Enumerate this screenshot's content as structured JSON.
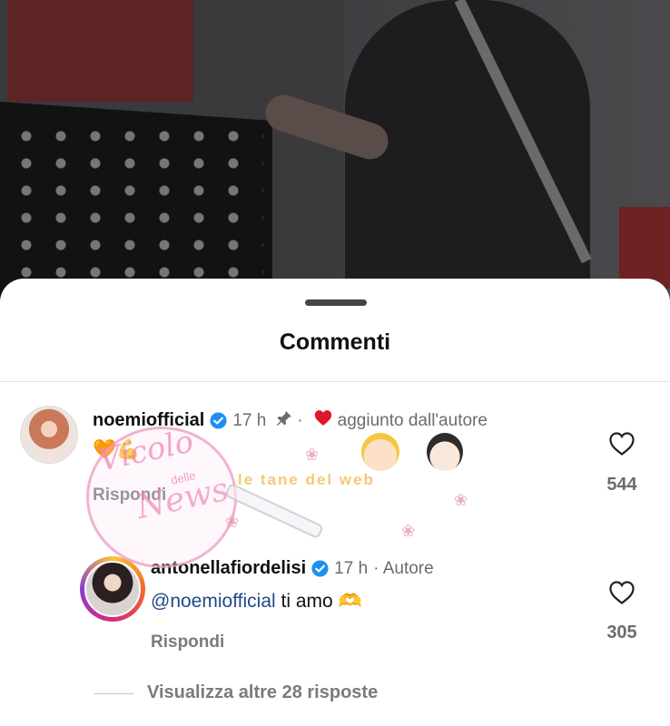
{
  "sheet": {
    "title": "Commenti"
  },
  "comments": [
    {
      "username": "noemiofficial",
      "time": "17 h",
      "liked_by_author_label": "aggiunto dall'autore",
      "body_emoji": "🧡💪",
      "reply_label": "Rispondi",
      "like_count": "544"
    }
  ],
  "replies": [
    {
      "username": "antonellafiordelisi",
      "time": "17 h",
      "author_tag": "· Autore",
      "mention": "@noemiofficial",
      "text": " ti amo ",
      "emoji": "🫶",
      "reply_label": "Rispondi",
      "like_count": "305"
    }
  ],
  "view_more": {
    "label": "Visualizza altre 28 risposte"
  },
  "watermark": {
    "line1": "Vicolo",
    "small": "delle",
    "line2": "News",
    "band": "le tane del web"
  },
  "colors": {
    "verified_badge": "#1e90f0",
    "liked_heart": "#e0162b",
    "mention": "#1f4a8a"
  }
}
